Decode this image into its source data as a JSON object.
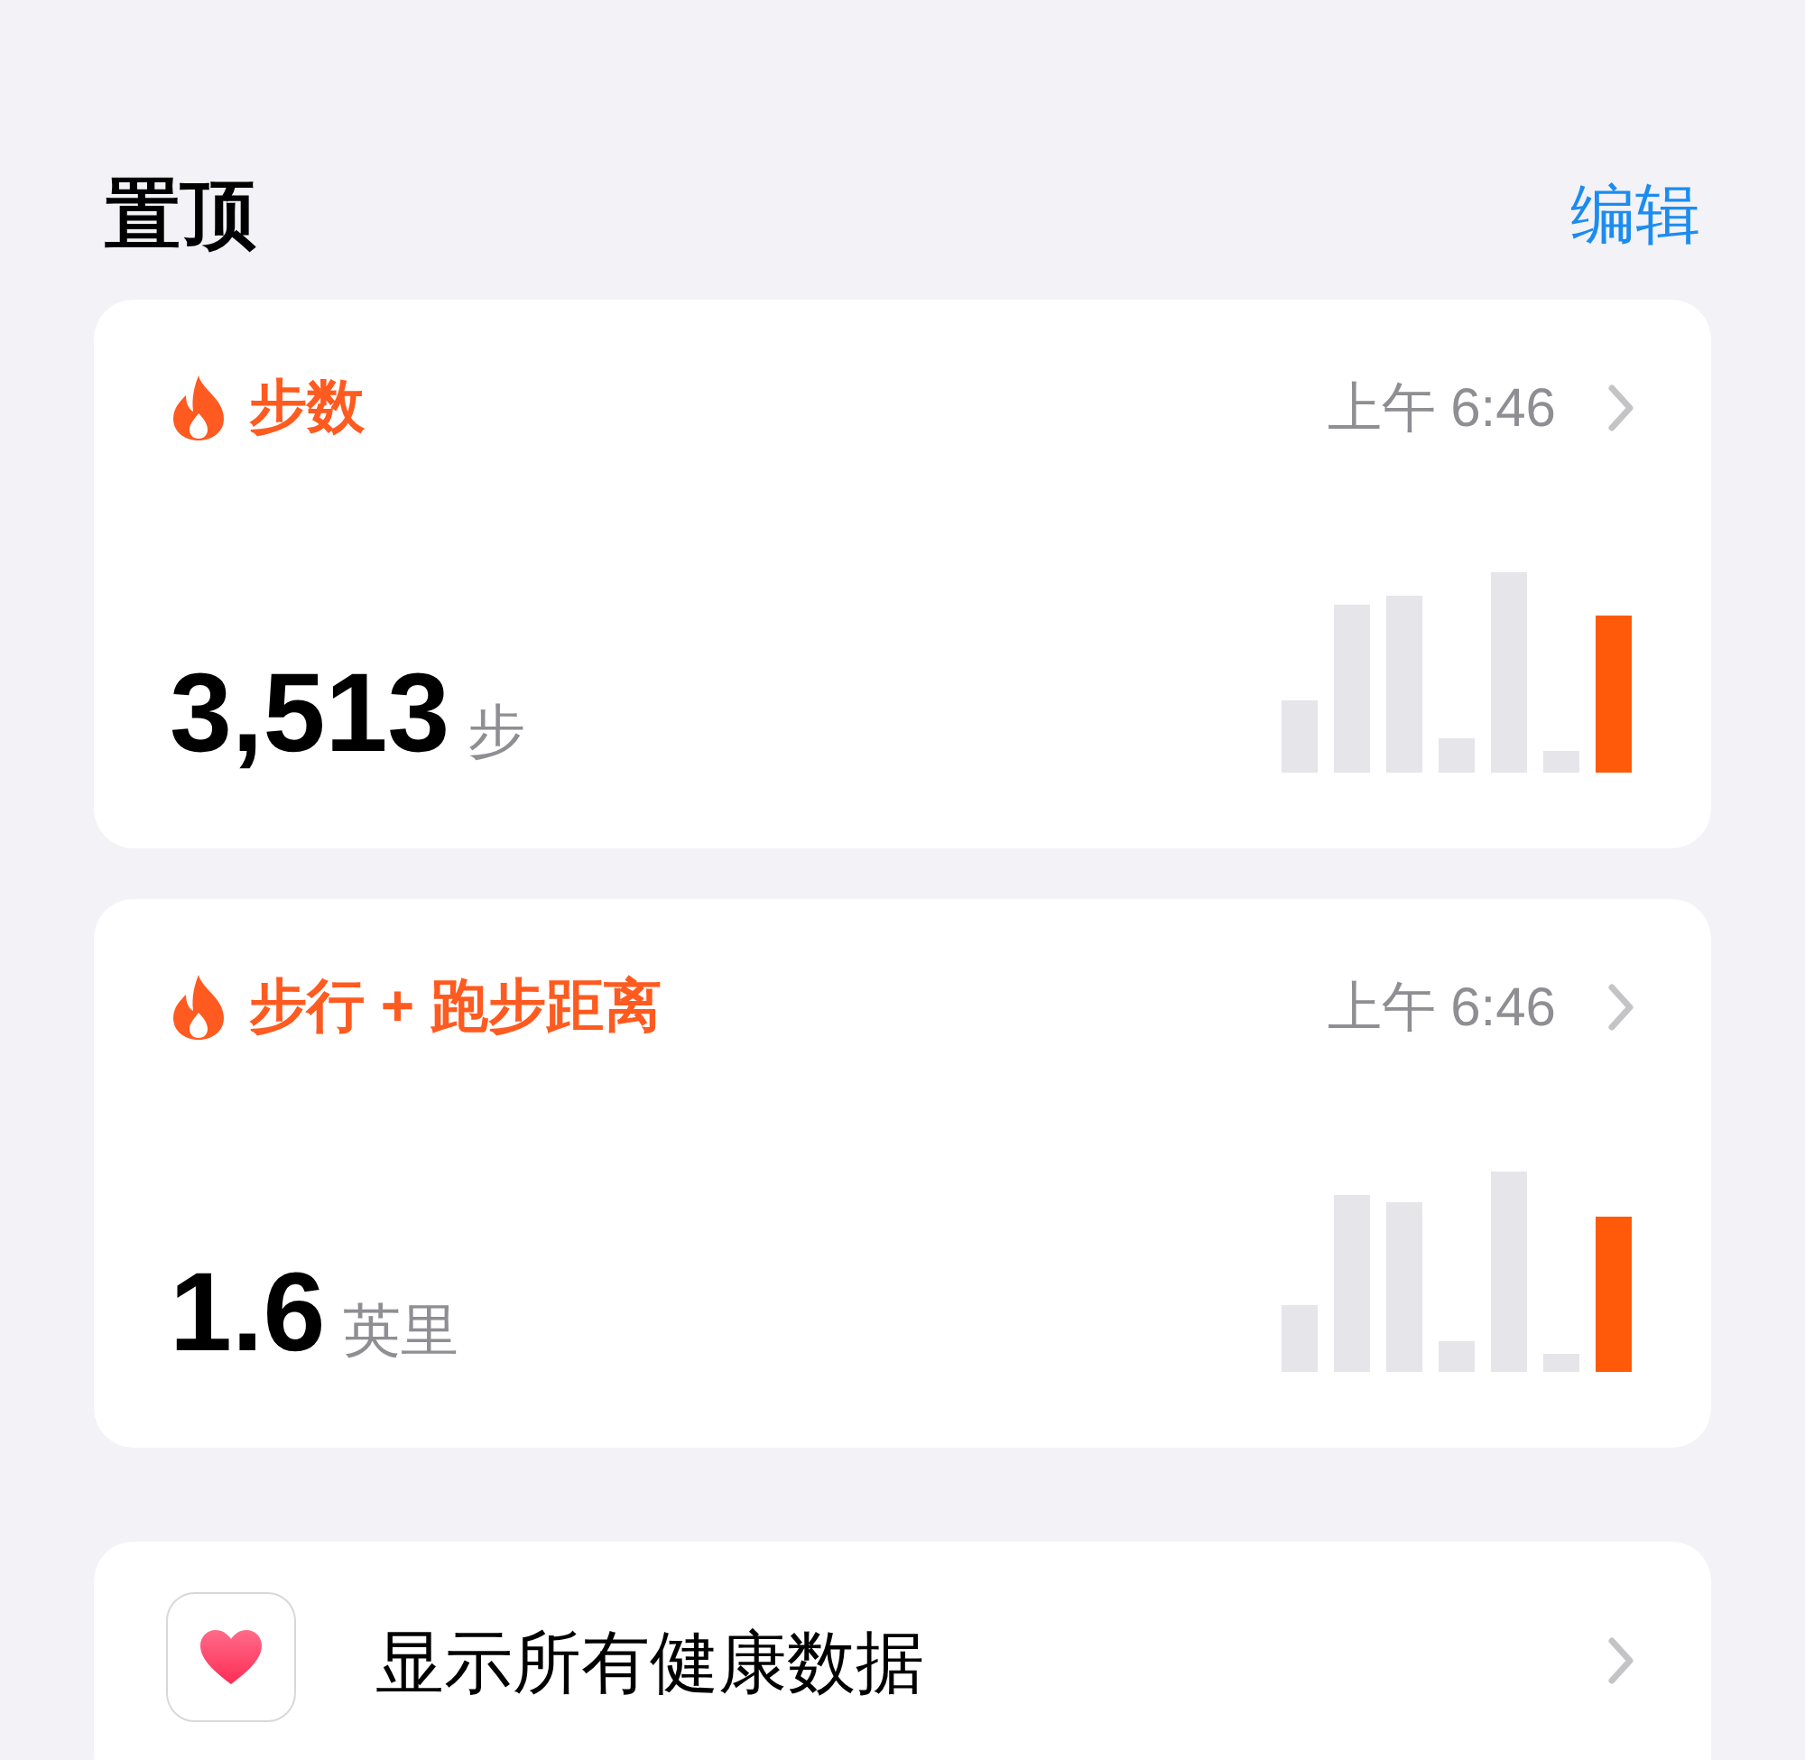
{
  "section": {
    "title": "置顶",
    "edit_button": "编辑"
  },
  "cards": [
    {
      "title": "步数",
      "time": "上午 6:46",
      "value": "3,513",
      "unit": "步"
    },
    {
      "title": "步行 + 跑步距离",
      "time": "上午 6:46",
      "value": "1.6",
      "unit": "英里"
    }
  ],
  "link": {
    "label": "显示所有健康数据"
  }
}
